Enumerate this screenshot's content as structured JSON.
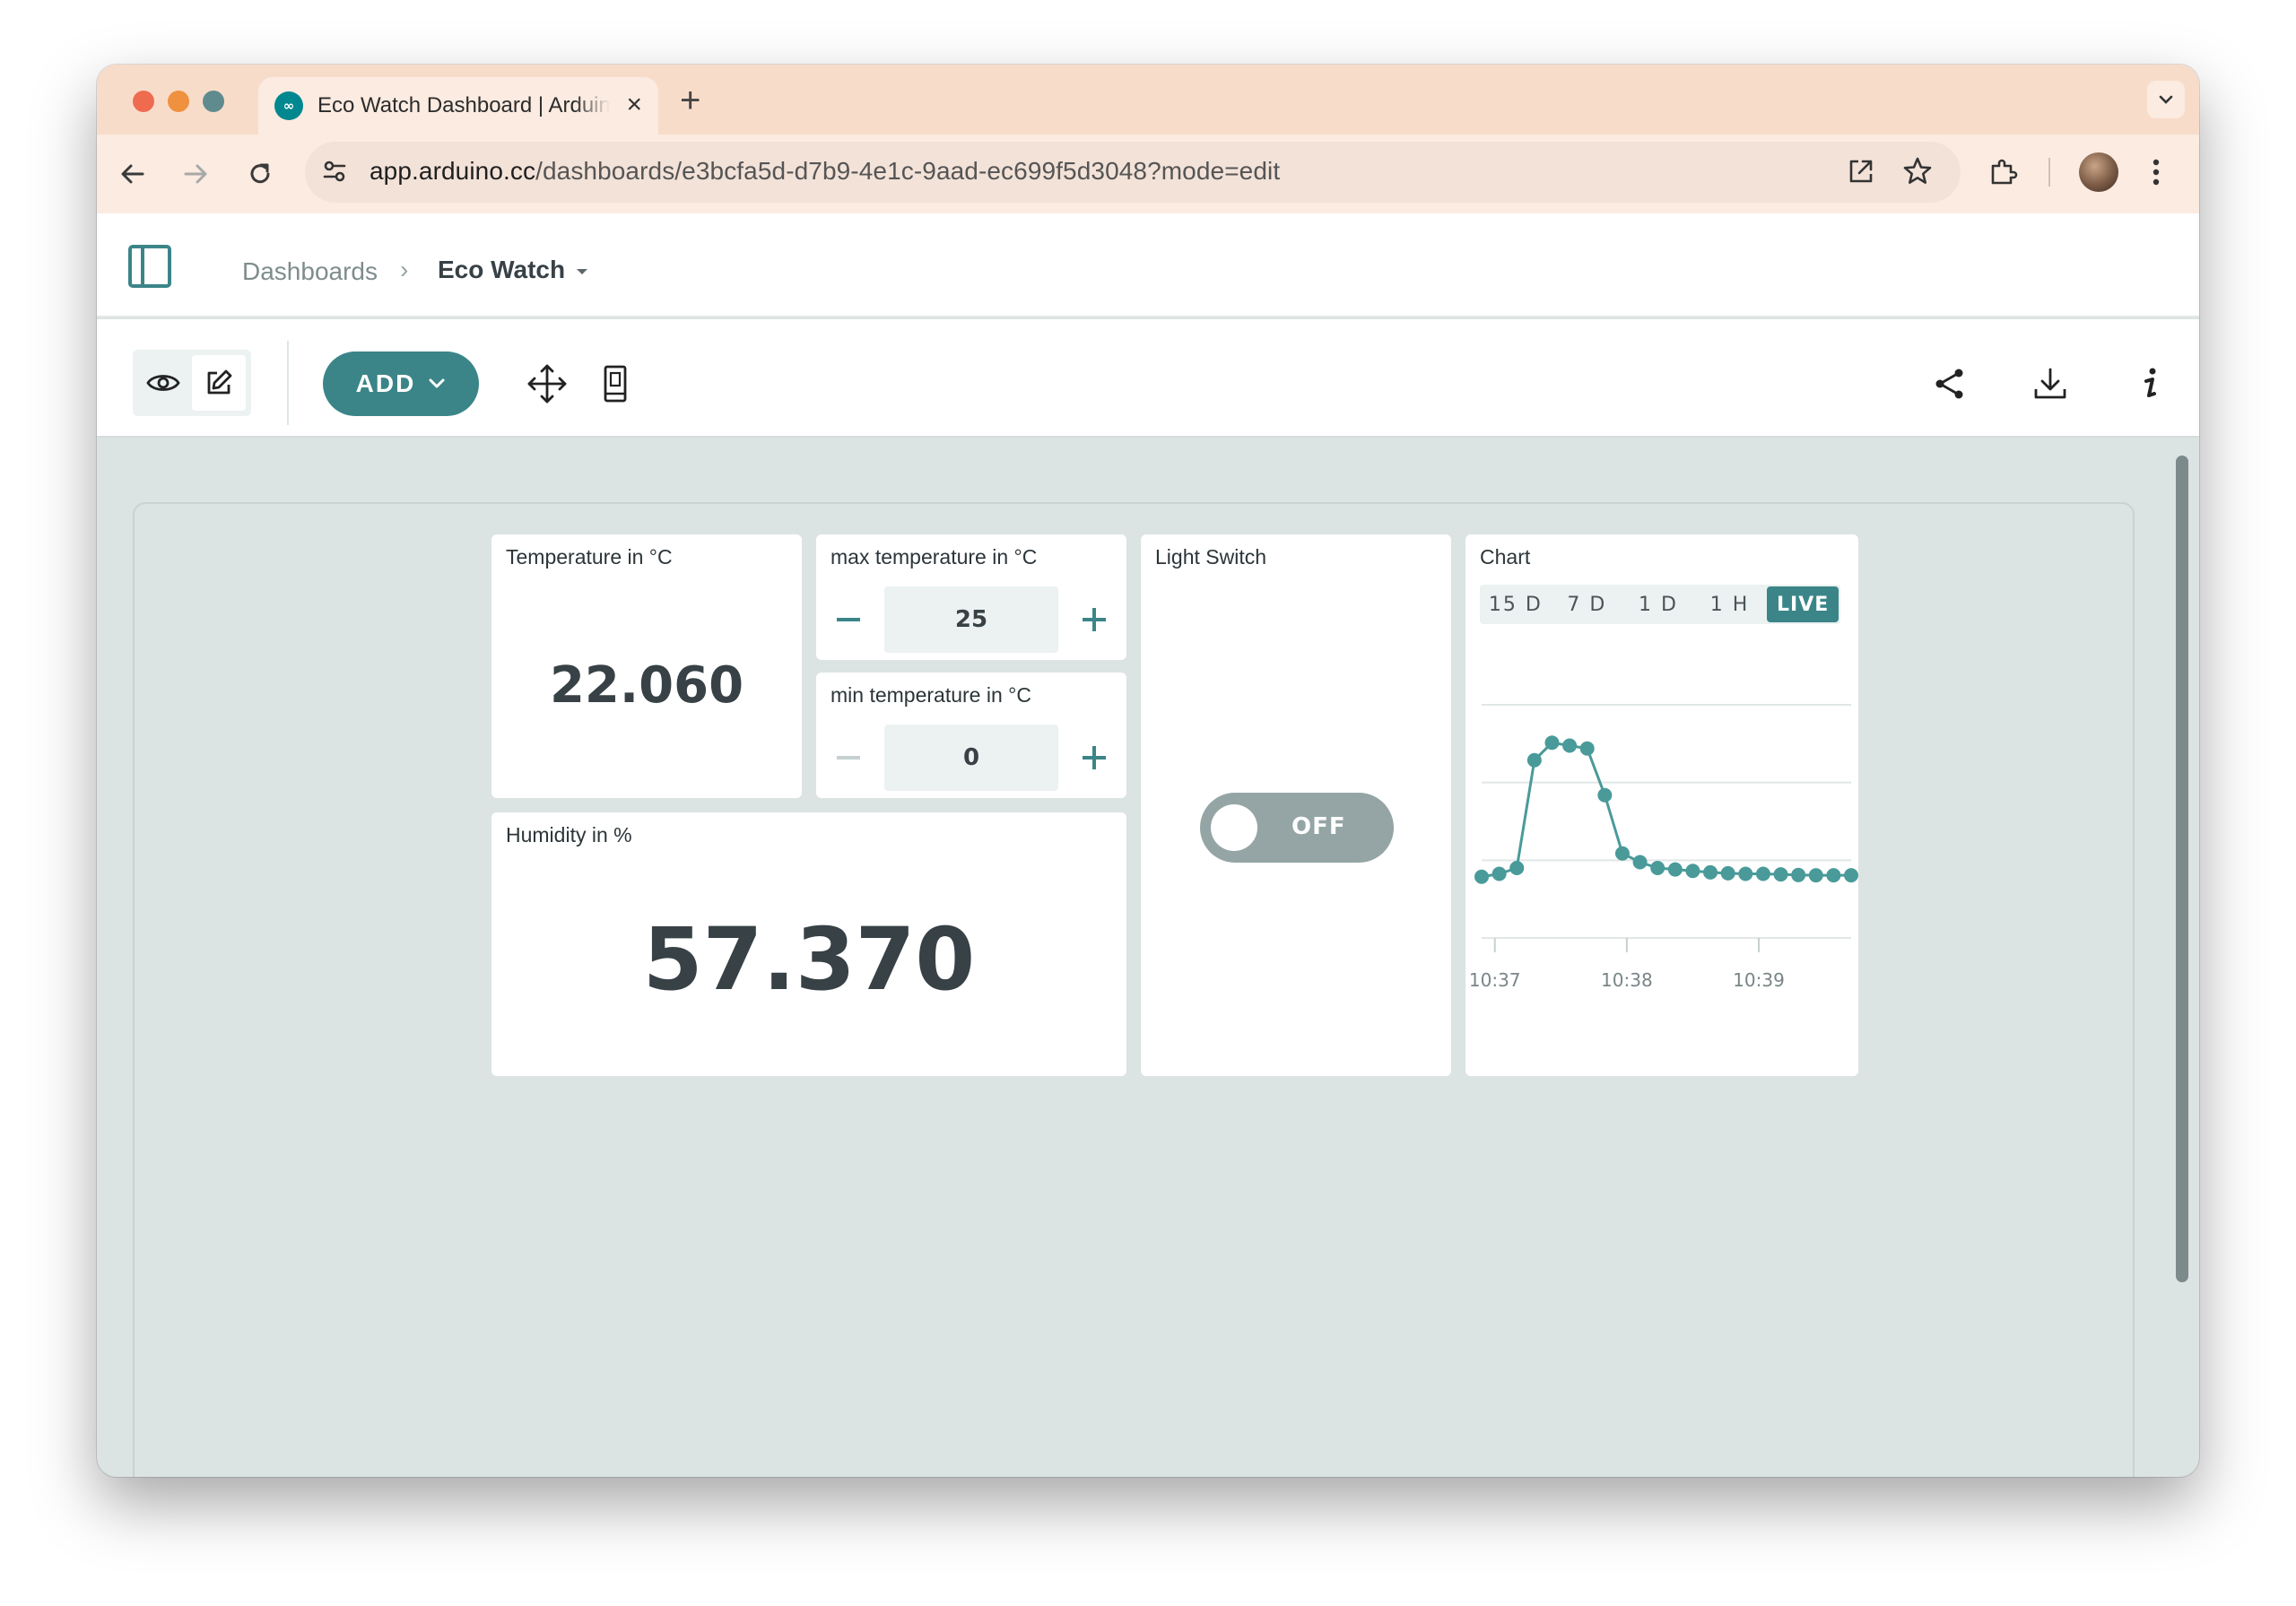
{
  "browser": {
    "tab_title": "Eco Watch Dashboard | Arduino Cloud",
    "favicon_glyph": "∞",
    "url_host": "app.arduino.cc",
    "url_path": "/dashboards/e3bcfa5d-d7b9-4e1c-9aad-ec699f5d3048?mode=edit"
  },
  "breadcrumb": {
    "root": "Dashboards",
    "separator": "›",
    "current": "Eco Watch"
  },
  "toolbar": {
    "add_label": "ADD"
  },
  "widgets": {
    "temperature": {
      "title": "Temperature in °C",
      "value": "22.060"
    },
    "max_temp": {
      "title": "max temperature in °C",
      "value": "25"
    },
    "min_temp": {
      "title": "min temperature in °C",
      "value": "0"
    },
    "humidity": {
      "title": "Humidity in %",
      "value": "57.370"
    },
    "light_switch": {
      "title": "Light Switch",
      "state_label": "OFF"
    },
    "chart": {
      "title": "Chart",
      "ranges": [
        "15 D",
        "7 D",
        "1 D",
        "1 H",
        "LIVE"
      ],
      "active_range": "LIVE"
    }
  },
  "colors": {
    "accent": "#3b8589",
    "series": "#4a9a9a",
    "canvas_bg": "#dce3e3",
    "toggle_off": "#95a5a6"
  },
  "chart_data": {
    "type": "line",
    "title": "",
    "x_ticks": [
      "10:37",
      "10:38",
      "10:39"
    ],
    "series": [
      {
        "name": "",
        "x": [
          "10:36:54",
          "10:37:02",
          "10:37:10",
          "10:37:18",
          "10:37:26",
          "10:37:34",
          "10:37:42",
          "10:37:50",
          "10:37:58",
          "10:38:06",
          "10:38:14",
          "10:38:22",
          "10:38:30",
          "10:38:38",
          "10:38:46",
          "10:38:54",
          "10:39:02",
          "10:39:10",
          "10:39:18",
          "10:39:26",
          "10:39:34",
          "10:39:42"
        ],
        "values": [
          20.1,
          20.2,
          20.4,
          24.1,
          24.7,
          24.6,
          24.5,
          22.9,
          20.9,
          20.6,
          20.4,
          20.35,
          20.3,
          20.25,
          20.22,
          20.2,
          20.2,
          20.18,
          20.16,
          20.15,
          20.15,
          20.15
        ]
      }
    ],
    "ylim": [
      18,
      26
    ],
    "grid": true,
    "legend": "none"
  }
}
